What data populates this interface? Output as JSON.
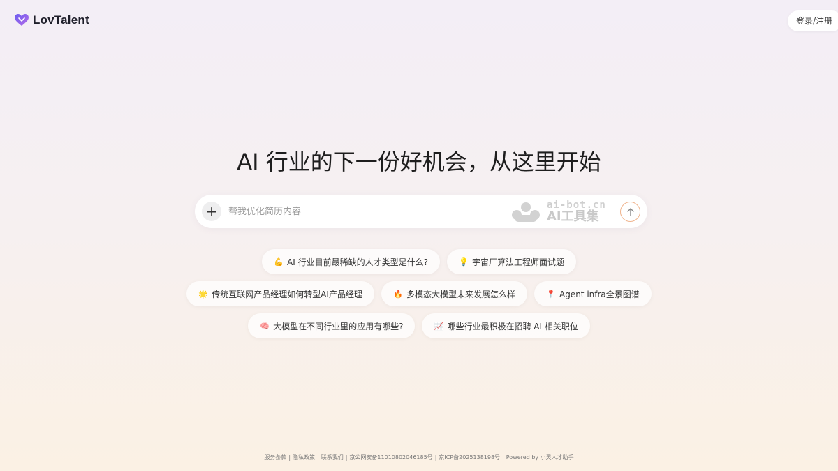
{
  "header": {
    "logo_text": "LovTalent",
    "login_label": "登录/注册"
  },
  "hero": {
    "headline": "AI 行业的下一份好机会，从这里开始"
  },
  "search": {
    "placeholder": "帮我优化简历内容",
    "watermark_top": "ai-bot.cn",
    "watermark_bottom": "AI工具集"
  },
  "suggestions": [
    [
      {
        "icon": "💪",
        "label": "AI 行业目前最稀缺的人才类型是什么?"
      },
      {
        "icon": "💡",
        "label": "宇宙厂算法工程师面试题"
      }
    ],
    [
      {
        "icon": "🌟",
        "label": "传统互联网产品经理如何转型AI产品经理"
      },
      {
        "icon": "🔥",
        "label": "多模态大模型未来发展怎么样"
      },
      {
        "icon": "📍",
        "label": "Agent infra全景图谱"
      }
    ],
    [
      {
        "icon": "🧠",
        "label": "大模型在不同行业里的应用有哪些?"
      },
      {
        "icon": "📈",
        "label": "哪些行业最积极在招聘 AI 相关职位"
      }
    ]
  ],
  "footer": {
    "links": [
      "服务条款",
      "隐私政策",
      "联系我们",
      "京公网安备11010802046185号",
      "京ICP备2025138198号",
      "Powered by 小灵人才助手"
    ]
  },
  "colors": {
    "send_border": "#f0b58f",
    "logo_gradient_start": "#7b6cf0",
    "logo_gradient_end": "#b66ce8"
  }
}
